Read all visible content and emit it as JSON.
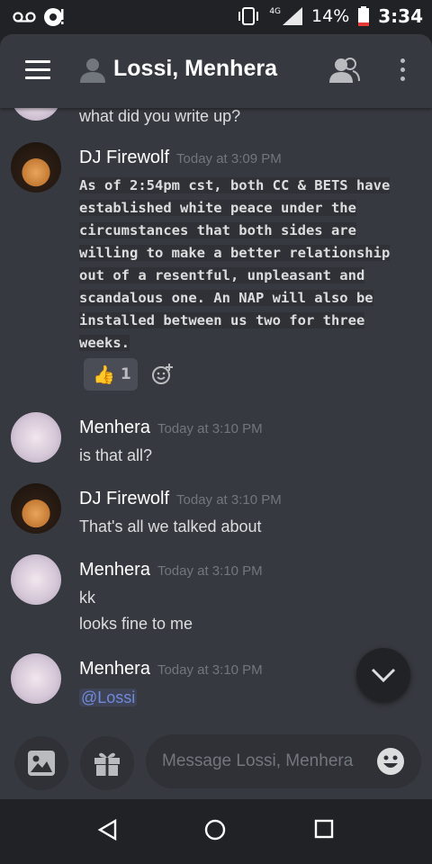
{
  "status_bar": {
    "network": "4G",
    "battery": "14%",
    "time": "3:34"
  },
  "header": {
    "title": "Lossi, Menhera"
  },
  "messages": [
    {
      "type": "continuation",
      "text": "what did you write up?"
    },
    {
      "type": "group",
      "author": "DJ Firewolf",
      "timestamp": "Today at 3:09 PM",
      "code_lines": [
        "As of 2:54pm cst, both CC & BETS have",
        "established white peace under the",
        "circumstances that both sides are",
        "willing to make a better relationship",
        "out of a resentful, unpleasant and",
        "scandalous one. An NAP will also be",
        "installed between us two for three",
        "weeks."
      ],
      "reaction": {
        "emoji": "👍",
        "count": "1"
      }
    },
    {
      "type": "group",
      "author": "Menhera",
      "timestamp": "Today at 3:10 PM",
      "lines": [
        "is that all?"
      ]
    },
    {
      "type": "group",
      "author": "DJ Firewolf",
      "timestamp": "Today at 3:10 PM",
      "lines": [
        "That's all we talked about"
      ]
    },
    {
      "type": "group",
      "author": "Menhera",
      "timestamp": "Today at 3:10 PM",
      "lines": [
        "kk",
        "looks fine to me"
      ]
    },
    {
      "type": "group",
      "author": "Menhera",
      "timestamp": "Today at 3:10 PM",
      "mention": "@Lossi"
    }
  ],
  "composer": {
    "placeholder": "Message Lossi, Menhera"
  },
  "colors": {
    "background": "#36393f",
    "dark": "#202225",
    "mention": "#7289da",
    "timestamp": "#72767d"
  },
  "icons": [
    "menu-icon",
    "dm-user-icon",
    "members-icon",
    "more-icon",
    "add-reaction-icon",
    "scroll-down-icon",
    "image-icon",
    "gift-icon",
    "emoji-icon",
    "back-icon",
    "home-icon",
    "recents-icon"
  ]
}
